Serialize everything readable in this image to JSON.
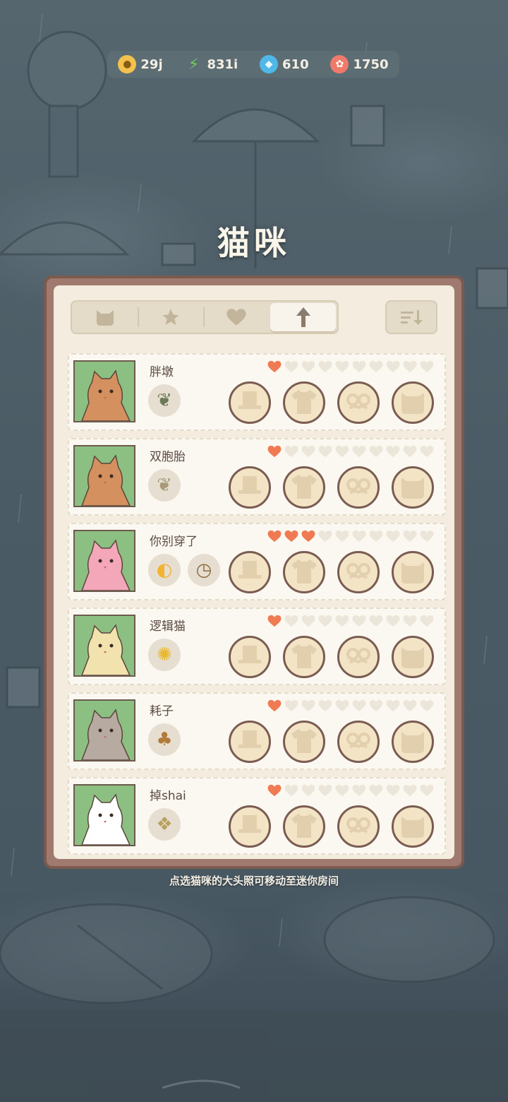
{
  "resources": [
    {
      "name": "coin",
      "value": "29j",
      "icon": "coin-icon",
      "color": "#f2c14e"
    },
    {
      "name": "energy",
      "value": "831i",
      "icon": "lightning-icon",
      "color": "#6fcf5a"
    },
    {
      "name": "diamond",
      "value": "610",
      "icon": "diamond-icon",
      "color": "#4fb8e8"
    },
    {
      "name": "candy",
      "value": "1750",
      "icon": "candy-icon",
      "color": "#ef7a6a"
    }
  ],
  "title": "猫咪",
  "tabs": [
    {
      "icon": "cat-icon"
    },
    {
      "icon": "star-icon"
    },
    {
      "icon": "heart-icon"
    },
    {
      "icon": "arrow-up-icon"
    }
  ],
  "sort_icon": "sort-icon",
  "cats": [
    {
      "name": "胖墩",
      "hearts": 1,
      "traits": [
        "plant-icon"
      ],
      "portrait_color": "#d4905f"
    },
    {
      "name": "双胞胎",
      "hearts": 1,
      "traits": [
        "wheat-icon"
      ],
      "portrait_color": "#d4905f"
    },
    {
      "name": "你别穿了",
      "hearts": 3,
      "traits": [
        "lemon-icon",
        "stopwatch-icon"
      ],
      "portrait_color": "#f4a7b9"
    },
    {
      "name": "逻辑猫",
      "hearts": 1,
      "traits": [
        "corn-icon"
      ],
      "portrait_color": "#f2e2ad"
    },
    {
      "name": "耗子",
      "hearts": 1,
      "traits": [
        "acorn-icon"
      ],
      "portrait_color": "#b7aaa0"
    },
    {
      "name": "掉shai",
      "hearts": 1,
      "traits": [
        "pineapple-icon"
      ],
      "portrait_color": "#ffffff"
    }
  ],
  "max_hearts": 10,
  "slots": [
    "hat-slot-icon",
    "shirt-slot-icon",
    "glasses-slot-icon",
    "face-slot-icon"
  ],
  "colors": {
    "heart_on": "#f07a52",
    "heart_off": "#ece6da",
    "panel": "#f3ecdf",
    "portrait_bg": "#8cbf82"
  },
  "hint": "点选猫咪的大头照可移动至迷你房间"
}
